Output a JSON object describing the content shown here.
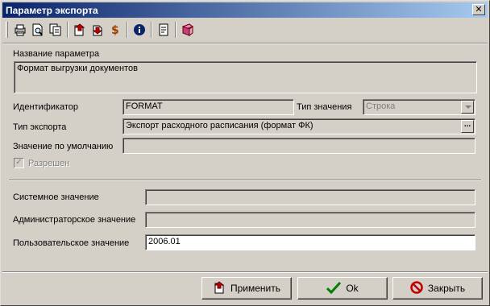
{
  "window": {
    "title": "Параметр экспорта",
    "close_glyph": "✕"
  },
  "toolbar": {
    "icons": [
      "print-icon",
      "preview-icon",
      "copy-doc-icon",
      "import-icon",
      "export-icon",
      "currency-icon",
      "info-icon",
      "report-icon",
      "book-icon"
    ]
  },
  "form": {
    "name_label": "Название параметра",
    "name_value": "Формат выгрузки документов",
    "id_label": "Идентификатор",
    "id_value": "FORMAT",
    "value_type_label": "Тип значения",
    "value_type_value": "Строка",
    "export_type_label": "Тип экспорта",
    "export_type_value": "Экспорт расходного расписания (формат ФК)",
    "export_type_button": "...",
    "default_label": "Значение по умолчанию",
    "default_value": "",
    "allowed_label": "Разрешен",
    "allowed_checked": true,
    "system_label": "Системное значение",
    "system_value": "",
    "admin_label": "Администраторское значение",
    "admin_value": "",
    "user_label": "Пользовательское значение",
    "user_value": "2006.01"
  },
  "buttons": {
    "apply": "Применить",
    "ok": "Ok",
    "close": "Закрыть"
  },
  "colors": {
    "titlebar_start": "#0a246a",
    "titlebar_end": "#a6caf0",
    "face": "#d4d0c8"
  }
}
